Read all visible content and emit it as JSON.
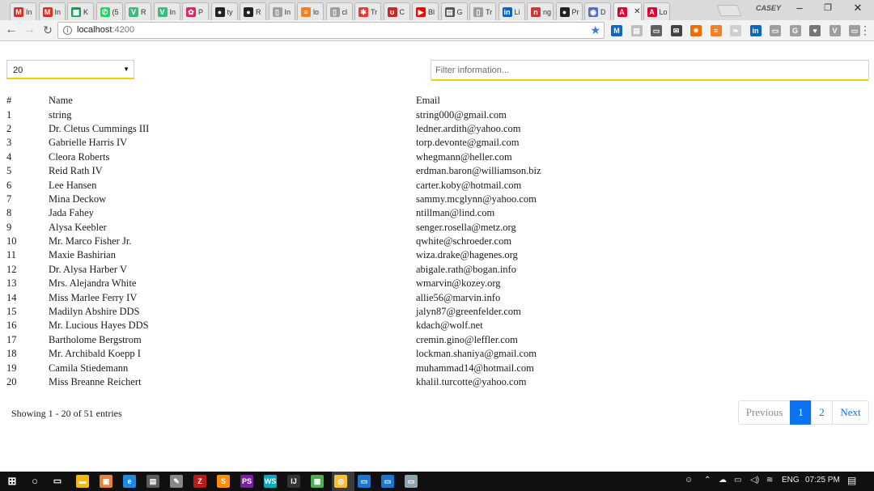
{
  "browser": {
    "tabs": [
      {
        "title": "In",
        "favicon": "gmail-icon",
        "color": "#d93025",
        "glyph": "M"
      },
      {
        "title": "In",
        "favicon": "gmail-icon",
        "color": "#d93025",
        "glyph": "M"
      },
      {
        "title": "K",
        "favicon": "sheets-icon",
        "color": "#0f9d58",
        "glyph": "▦"
      },
      {
        "title": "(5",
        "favicon": "whatsapp-icon",
        "color": "#25d366",
        "glyph": "✆"
      },
      {
        "title": "R",
        "favicon": "vue-icon",
        "color": "#41b883",
        "glyph": "V"
      },
      {
        "title": "In",
        "favicon": "vue-icon",
        "color": "#41b883",
        "glyph": "V"
      },
      {
        "title": "P",
        "favicon": "puppy-icon",
        "color": "#e0245e",
        "glyph": "✿"
      },
      {
        "title": "ty",
        "favicon": "github-icon",
        "color": "#222222",
        "glyph": "●"
      },
      {
        "title": "R",
        "favicon": "github-icon",
        "color": "#222222",
        "glyph": "●"
      },
      {
        "title": "In",
        "favicon": "page-icon",
        "color": "#9e9e9e",
        "glyph": "▯"
      },
      {
        "title": "lo",
        "favicon": "stackoverflow-icon",
        "color": "#f48024",
        "glyph": "≡"
      },
      {
        "title": "cl",
        "favicon": "page-icon",
        "color": "#9e9e9e",
        "glyph": "▯"
      },
      {
        "title": "Tr",
        "favicon": "figure-icon",
        "color": "#e53935",
        "glyph": "✱"
      },
      {
        "title": "C",
        "favicon": "scribd-icon",
        "color": "#c62828",
        "glyph": "ʊ"
      },
      {
        "title": "Bl",
        "favicon": "youtube-icon",
        "color": "#ff0000",
        "glyph": "▶"
      },
      {
        "title": "G",
        "favicon": "book-icon",
        "color": "#555555",
        "glyph": "▤"
      },
      {
        "title": "Tr",
        "favicon": "page-icon",
        "color": "#9e9e9e",
        "glyph": "▯"
      },
      {
        "title": "Li",
        "favicon": "linkedin-icon",
        "color": "#0a66c2",
        "glyph": "in"
      },
      {
        "title": "ng",
        "favicon": "npm-icon",
        "color": "#cb3837",
        "glyph": "n"
      },
      {
        "title": "Pr",
        "favicon": "github-icon",
        "color": "#222222",
        "glyph": "●"
      },
      {
        "title": "D",
        "favicon": "circle-icon",
        "color": "#5c6bc0",
        "glyph": "◉"
      },
      {
        "title": "",
        "favicon": "angular-icon",
        "color": "#dd0031",
        "glyph": "A",
        "active": true
      },
      {
        "title": "Lo",
        "favicon": "angular-icon",
        "color": "#dd0031",
        "glyph": "A"
      }
    ],
    "profile_name": "CASEY",
    "address": {
      "host": "localhost",
      "port": ":4200"
    },
    "extensions": [
      {
        "name": "m-extension-icon",
        "color": "#1565c0",
        "glyph": "M"
      },
      {
        "name": "reader-icon",
        "color": "#bdbdbd",
        "glyph": "▤"
      },
      {
        "name": "cast-icon",
        "color": "#616161",
        "glyph": "▭"
      },
      {
        "name": "mail-icon",
        "color": "#424242",
        "glyph": "✉"
      },
      {
        "name": "orange-extension-icon",
        "color": "#ef6c00",
        "glyph": "✷"
      },
      {
        "name": "stackoverflow-extension-icon",
        "color": "#f48024",
        "glyph": "≡"
      },
      {
        "name": "feather-icon",
        "color": "#cfcfcf",
        "glyph": "❧"
      },
      {
        "name": "linkedin-extension-icon",
        "color": "#0a66c2",
        "glyph": "in"
      },
      {
        "name": "inbox-icon",
        "color": "#9e9e9e",
        "glyph": "▭"
      },
      {
        "name": "grammarly-icon",
        "color": "#9e9e9e",
        "glyph": "G"
      },
      {
        "name": "pocket-icon",
        "color": "#757575",
        "glyph": "♥"
      },
      {
        "name": "vue-devtools-icon",
        "color": "#9e9e9e",
        "glyph": "V"
      },
      {
        "name": "bookmark-manager-icon",
        "color": "#9e9e9e",
        "glyph": "▭"
      }
    ]
  },
  "controls": {
    "page_size": "20",
    "filter_placeholder": "Filter information..."
  },
  "table": {
    "headers": {
      "num": "#",
      "name": "Name",
      "email": "Email"
    },
    "rows": [
      {
        "num": "1",
        "name": "string",
        "email": "string000@gmail.com"
      },
      {
        "num": "2",
        "name": "Dr. Cletus Cummings III",
        "email": "ledner.ardith@yahoo.com"
      },
      {
        "num": "3",
        "name": "Gabrielle Harris IV",
        "email": "torp.devonte@gmail.com"
      },
      {
        "num": "4",
        "name": "Cleora Roberts",
        "email": "whegmann@heller.com"
      },
      {
        "num": "5",
        "name": "Reid Rath IV",
        "email": "erdman.baron@williamson.biz"
      },
      {
        "num": "6",
        "name": "Lee Hansen",
        "email": "carter.koby@hotmail.com"
      },
      {
        "num": "7",
        "name": "Mina Deckow",
        "email": "sammy.mcglynn@yahoo.com"
      },
      {
        "num": "8",
        "name": "Jada Fahey",
        "email": "ntillman@lind.com"
      },
      {
        "num": "9",
        "name": "Alysa Keebler",
        "email": "senger.rosella@metz.org"
      },
      {
        "num": "10",
        "name": "Mr. Marco Fisher Jr.",
        "email": "qwhite@schroeder.com"
      },
      {
        "num": "11",
        "name": "Maxie Bashirian",
        "email": "wiza.drake@hagenes.org"
      },
      {
        "num": "12",
        "name": "Dr. Alysa Harber V",
        "email": "abigale.rath@bogan.info"
      },
      {
        "num": "13",
        "name": "Mrs. Alejandra White",
        "email": "wmarvin@kozey.org"
      },
      {
        "num": "14",
        "name": "Miss Marlee Ferry IV",
        "email": "allie56@marvin.info"
      },
      {
        "num": "15",
        "name": "Madilyn Abshire DDS",
        "email": "jalyn87@greenfelder.com"
      },
      {
        "num": "16",
        "name": "Mr. Lucious Hayes DDS",
        "email": "kdach@wolf.net"
      },
      {
        "num": "17",
        "name": "Bartholome Bergstrom",
        "email": "cremin.gino@leffler.com"
      },
      {
        "num": "18",
        "name": "Mr. Archibald Koepp I",
        "email": "lockman.shaniya@gmail.com"
      },
      {
        "num": "19",
        "name": "Camila Stiedemann",
        "email": "muhammad14@hotmail.com"
      },
      {
        "num": "20",
        "name": "Miss Breanne Reichert",
        "email": "khalil.turcotte@yahoo.com"
      }
    ]
  },
  "footer": {
    "showing": "Showing 1 - 20 of 51 entries",
    "pagination": {
      "previous": "Previous",
      "pages": [
        "1",
        "2"
      ],
      "current": "1",
      "next": "Next"
    }
  },
  "taskbar": {
    "apps": [
      {
        "name": "file-explorer-icon",
        "color": "#f2b81a",
        "glyph": "▬"
      },
      {
        "name": "sublime-icon",
        "color": "#e8813a",
        "glyph": "▣"
      },
      {
        "name": "edge-icon",
        "color": "#1e88e5",
        "glyph": "e"
      },
      {
        "name": "store-icon",
        "color": "#5c5c5c",
        "glyph": "▤"
      },
      {
        "name": "paint-icon",
        "color": "#888888",
        "glyph": "✎"
      },
      {
        "name": "filezilla-icon",
        "color": "#b71c1c",
        "glyph": "Z"
      },
      {
        "name": "sublime-text-icon",
        "color": "#ff8f00",
        "glyph": "S"
      },
      {
        "name": "phpstorm-icon",
        "color": "#7b1fa2",
        "glyph": "PS"
      },
      {
        "name": "webstorm-icon",
        "color": "#00acc1",
        "glyph": "WS"
      },
      {
        "name": "intellij-icon",
        "color": "#333333",
        "glyph": "IJ"
      },
      {
        "name": "photo-icon",
        "color": "#4caf50",
        "glyph": "▦"
      },
      {
        "name": "chrome-icon",
        "color": "#fbc02d",
        "glyph": "◎"
      },
      {
        "name": "window-app-icon",
        "color": "#1976d2",
        "glyph": "▭"
      },
      {
        "name": "window-app-icon",
        "color": "#1976d2",
        "glyph": "▭"
      },
      {
        "name": "network-app-icon",
        "color": "#90a4ae",
        "glyph": "▭"
      }
    ],
    "language": "ENG",
    "time": "07:25 PM"
  }
}
